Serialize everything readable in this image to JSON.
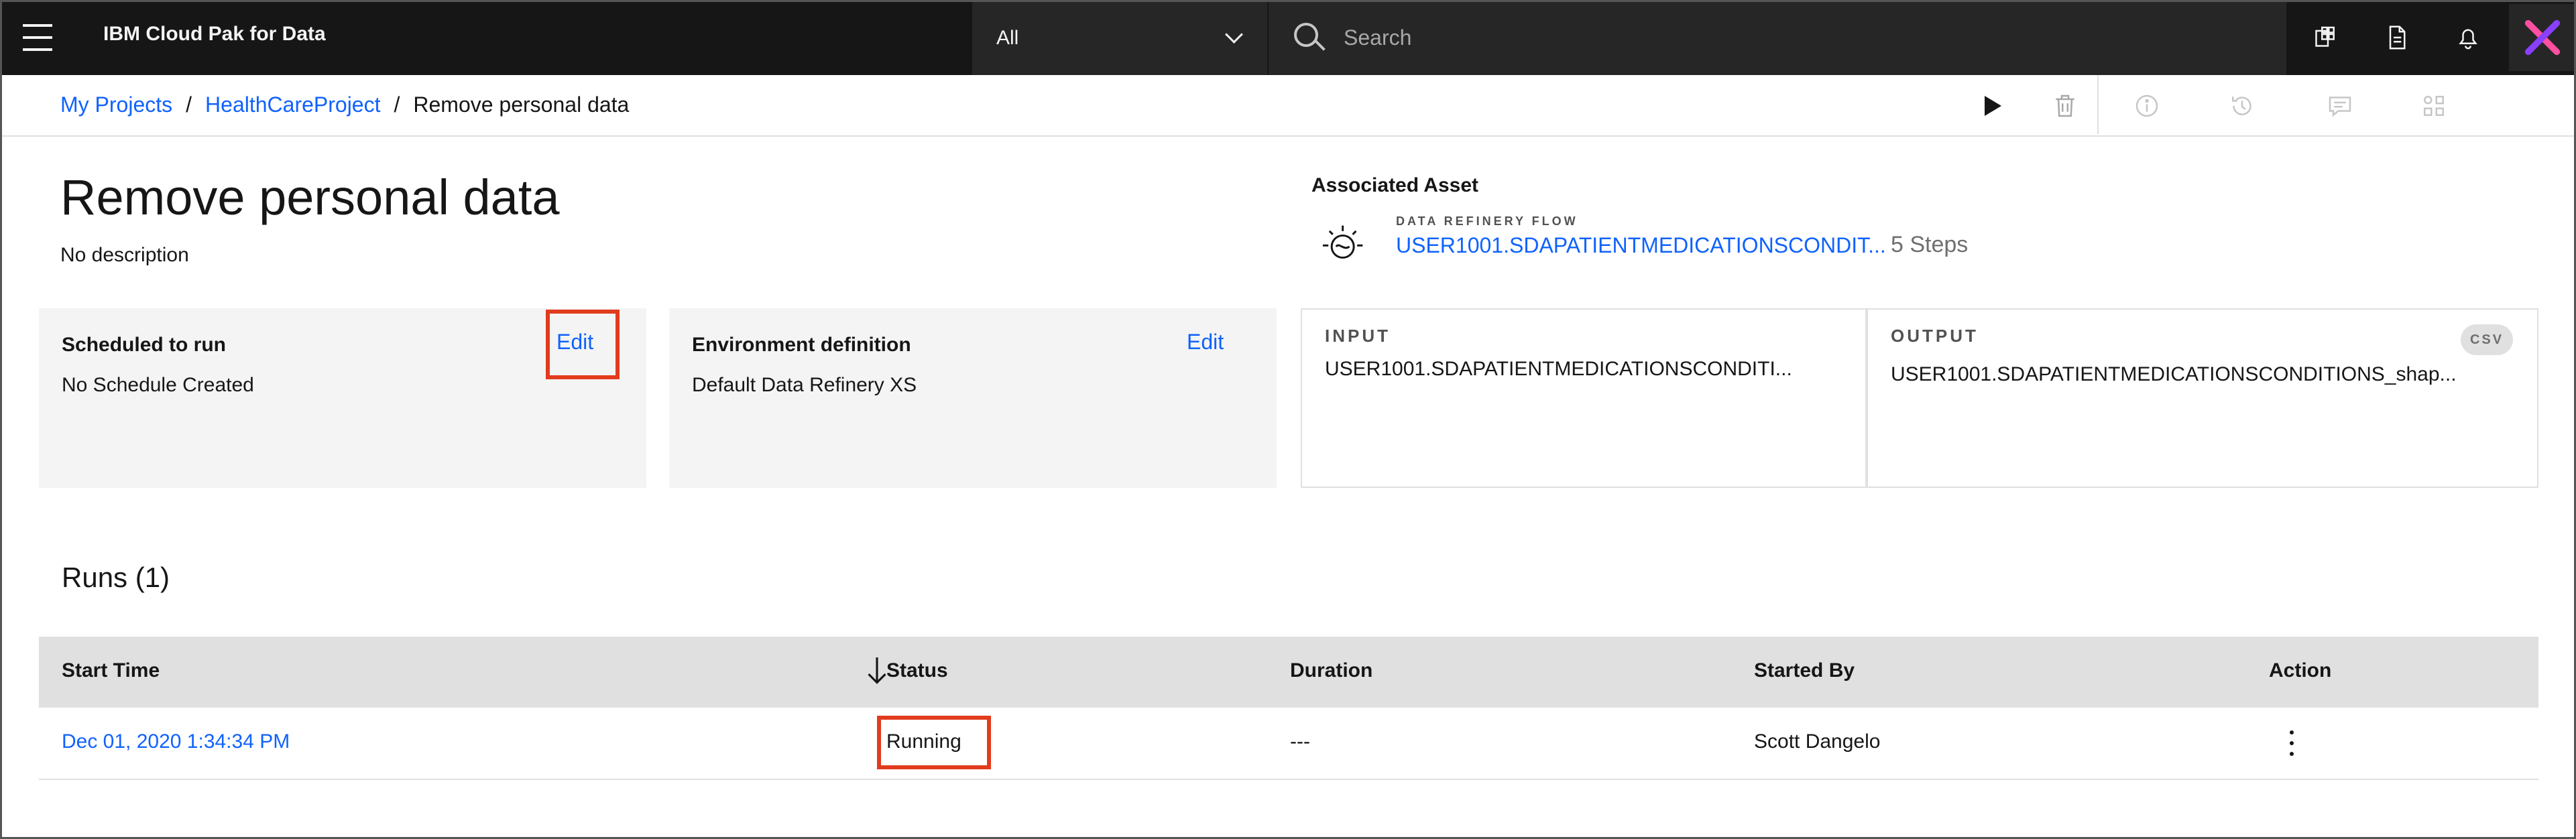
{
  "header": {
    "brand": "IBM Cloud Pak for Data",
    "scope_value": "All",
    "search_placeholder": "Search",
    "icons": [
      "hamburger-menu-icon",
      "catalog-icon",
      "document-icon",
      "notification-bell-icon",
      "user-avatar-icon"
    ]
  },
  "breadcrumb": {
    "items": [
      "My Projects",
      "HealthCareProject"
    ],
    "separator": "/",
    "current": "Remove personal data"
  },
  "toolbar": {
    "icons": [
      "run-play-icon",
      "trash-icon",
      "info-icon",
      "history-icon",
      "comment-icon",
      "integration-icon"
    ]
  },
  "page": {
    "title": "Remove personal data",
    "description": "No description"
  },
  "associated_asset": {
    "label": "Associated Asset",
    "type": "DATA REFINERY FLOW",
    "name": "USER1001.SDAPATIENTMEDICATIONSCONDIT...",
    "steps": "5 Steps"
  },
  "schedule": {
    "label": "Scheduled to run",
    "value": "No Schedule Created",
    "edit": "Edit"
  },
  "environment": {
    "label": "Environment definition",
    "value": "Default Data Refinery XS",
    "edit": "Edit"
  },
  "input": {
    "label": "INPUT",
    "value": "USER1001.SDAPATIENTMEDICATIONSCONDITI..."
  },
  "output": {
    "label": "OUTPUT",
    "badge": "CSV",
    "value": "USER1001.SDAPATIENTMEDICATIONSCONDITIONS_shap..."
  },
  "runs": {
    "title": "Runs (1)",
    "columns": [
      "Start Time",
      "Status",
      "Duration",
      "Started By",
      "Action"
    ],
    "rows": [
      {
        "start_time": "Dec 01, 2020 1:34:34 PM",
        "status": "Running",
        "duration": "---",
        "started_by": "Scott Dangelo"
      }
    ]
  },
  "colors": {
    "header_bg": "#161616",
    "link": "#0f62fe",
    "tile_bg": "#f4f4f4",
    "table_header_bg": "#e0e0e0",
    "highlight": "#e23b1e"
  }
}
